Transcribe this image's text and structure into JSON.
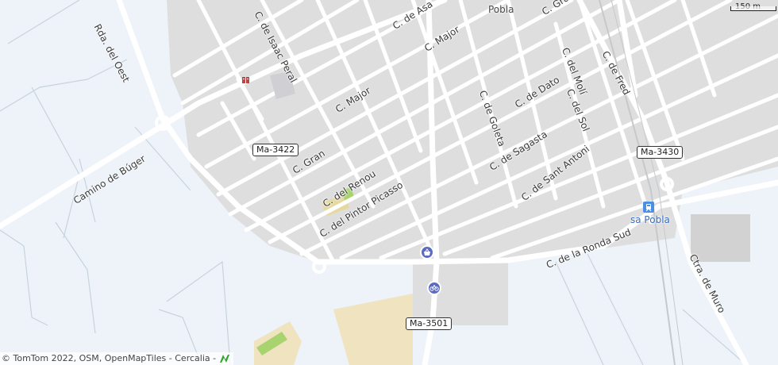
{
  "map": {
    "colors": {
      "background": "#edf3f8",
      "town": "#dedede",
      "road": "#ffffff",
      "park": "#cde3a3",
      "sand": "#f0e3bf",
      "station": "#4a8fe0"
    },
    "streets": [
      {
        "id": "c-de-isaac-peral",
        "label": "C. de Isaac Peral"
      },
      {
        "id": "rda-del-oest",
        "label": "Rda. del Oest"
      },
      {
        "id": "c-de-asa",
        "label": "C. de Asa"
      },
      {
        "id": "c-major-north",
        "label": "C. Major"
      },
      {
        "id": "c-major",
        "label": "C. Major"
      },
      {
        "id": "c-de-goleta",
        "label": "C. de Goleta"
      },
      {
        "id": "c-de-dato",
        "label": "C. de Dato"
      },
      {
        "id": "c-del-moli",
        "label": "C. del Molí"
      },
      {
        "id": "c-del-sol",
        "label": "C. del Sol"
      },
      {
        "id": "c-de-fred",
        "label": "C. de Fred"
      },
      {
        "id": "c-gra-top",
        "label": "C. Gra"
      },
      {
        "id": "c-gran",
        "label": "C. Gran"
      },
      {
        "id": "camino-de-buger",
        "label": "Camino de Búger"
      },
      {
        "id": "c-del-renou",
        "label": "C. del Renou"
      },
      {
        "id": "c-del-pintor-picasso",
        "label": "C. del Pintor Picasso"
      },
      {
        "id": "c-de-sagasta",
        "label": "C. de Sagasta"
      },
      {
        "id": "c-de-sant-antoni",
        "label": "C. de Sant Antoni"
      },
      {
        "id": "c-de-la-ronda-sud",
        "label": "C. de la Ronda Sud"
      },
      {
        "id": "ctra-de-muro",
        "label": "Ctra. de Muro"
      }
    ],
    "shields": {
      "ma3422": "Ma-3422",
      "ma3430": "Ma-3430",
      "ma3501": "Ma-3501"
    },
    "places": {
      "town": "Pobla",
      "station": "sa Pobla"
    },
    "scale": {
      "label": "150 m"
    },
    "attribution": "© TomTom 2022, OSM, OpenMapTiles - Cercalia -",
    "icons": {
      "station": "train-station-icon",
      "market": "shopping-basket-icon",
      "bicycle": "bicycle-icon",
      "hotel": "hotel-icon",
      "logo": "cercalia-logo-icon"
    }
  }
}
